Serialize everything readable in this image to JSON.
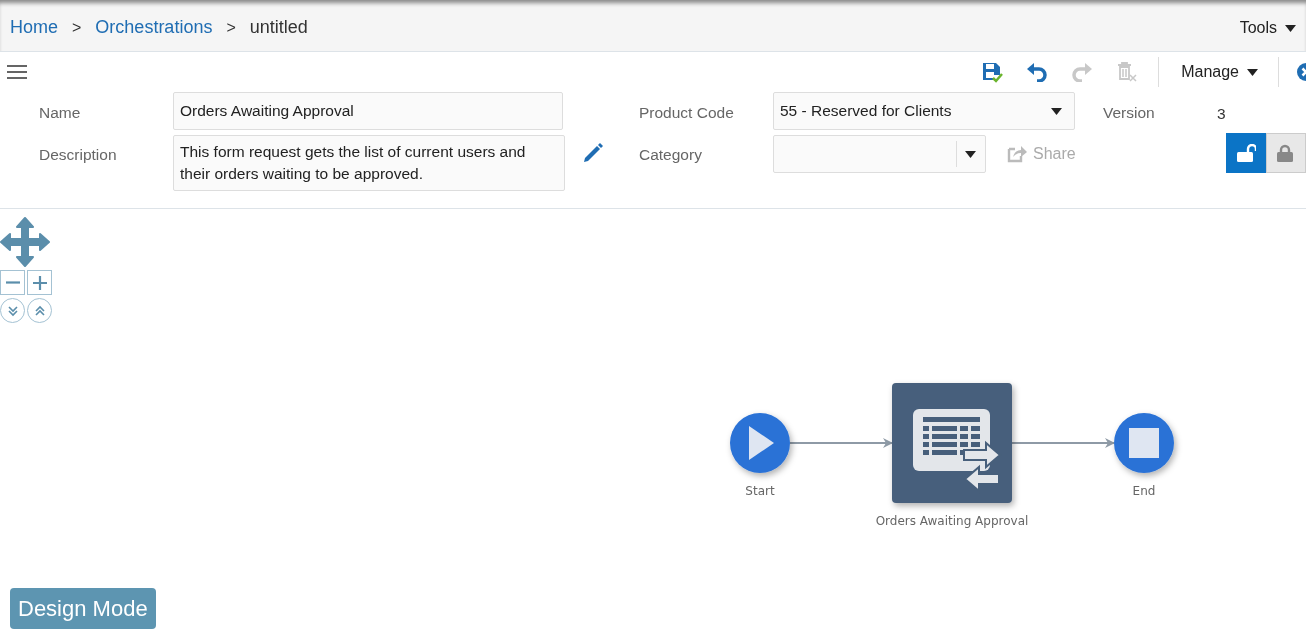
{
  "breadcrumb": [
    {
      "label": "Home",
      "kind": "link"
    },
    {
      "label": "Orchestrations",
      "kind": "link"
    },
    {
      "label": "untitled",
      "kind": "current"
    }
  ],
  "breadcrumb_separator": ">",
  "tools_menu": {
    "label": "Tools"
  },
  "toolbar": [
    {
      "kind": "save",
      "disabled": false
    },
    {
      "kind": "undo",
      "disabled": false
    },
    {
      "kind": "redo",
      "disabled": true
    },
    {
      "kind": "delete",
      "disabled": true
    }
  ],
  "manage_menu": {
    "label": "Manage"
  },
  "form": {
    "name": {
      "label": "Name",
      "value": "Orders Awaiting Approval"
    },
    "description": {
      "label": "Description",
      "value": "This form request gets the list of current users and their orders waiting to be approved."
    },
    "product_code": {
      "label": "Product Code",
      "value": "55 - Reserved for Clients"
    },
    "category": {
      "label": "Category"
    },
    "share": {
      "label": "Share",
      "disabled": true
    },
    "version": {
      "label": "Version",
      "value": "3"
    },
    "lock_toggle": [
      {
        "kind": "unlocked",
        "selected": true
      },
      {
        "kind": "locked",
        "selected": false
      }
    ]
  },
  "diagram": {
    "nodes": [
      {
        "kind": "start",
        "label": "Start"
      },
      {
        "kind": "task",
        "label": "Orders Awaiting Approval"
      },
      {
        "kind": "end",
        "label": "End"
      }
    ]
  },
  "mode_button": {
    "label": "Design Mode"
  }
}
